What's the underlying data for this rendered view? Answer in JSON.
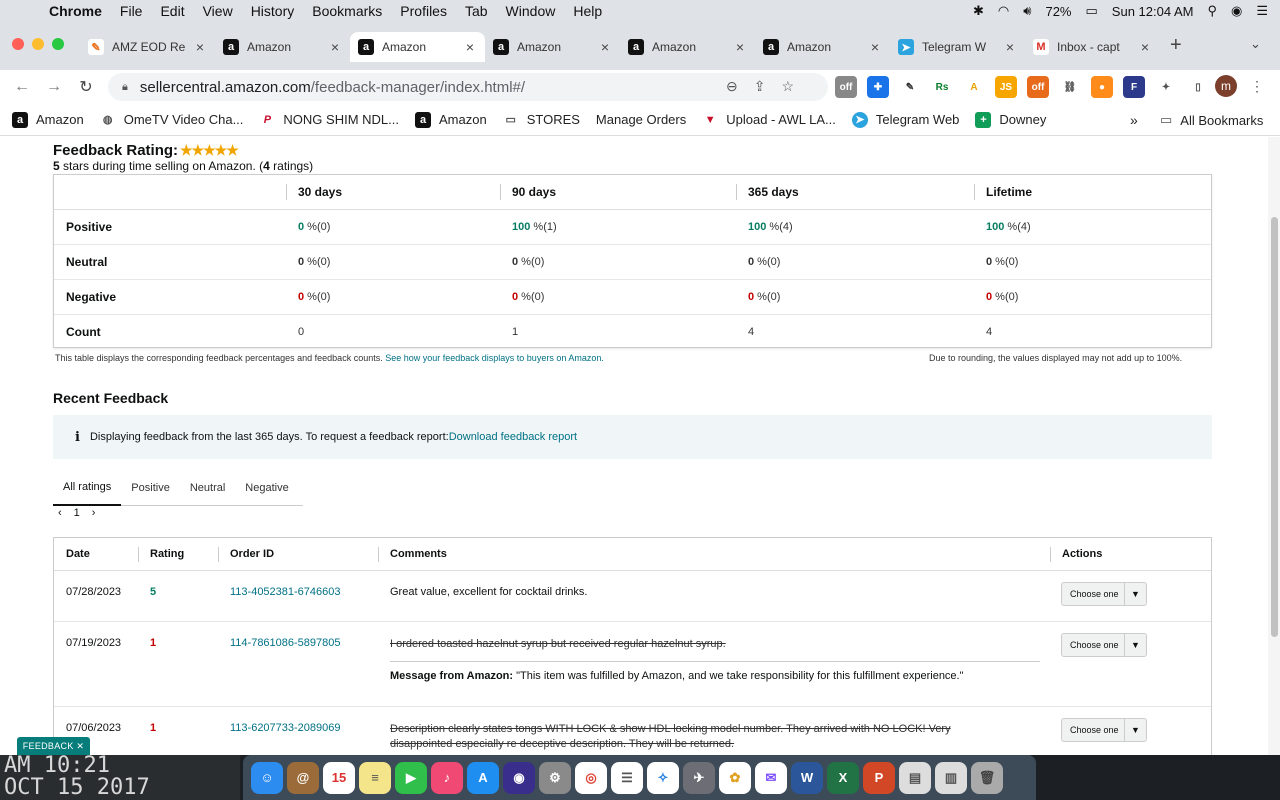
{
  "menubar": {
    "app": "Chrome",
    "items": [
      "File",
      "Edit",
      "View",
      "History",
      "Bookmarks",
      "Profiles",
      "Tab",
      "Window",
      "Help"
    ],
    "battery": "72%",
    "clock": "Sun 12:04 AM"
  },
  "tabs": [
    {
      "title": "AMZ EOD Re",
      "icon": "sheets-icon"
    },
    {
      "title": "Amazon",
      "icon": "amazon-icon"
    },
    {
      "title": "Amazon",
      "icon": "amazon-icon",
      "active": true
    },
    {
      "title": "Amazon",
      "icon": "amazon-icon"
    },
    {
      "title": "Amazon",
      "icon": "amazon-icon"
    },
    {
      "title": "Amazon",
      "icon": "amazon-icon"
    },
    {
      "title": "Telegram W",
      "icon": "telegram-icon"
    },
    {
      "title": "Inbox - capt",
      "icon": "gmail-icon"
    }
  ],
  "address": {
    "host": "sellercentral.amazon.com",
    "path": "/feedback-manager/index.html#/"
  },
  "profile_initial": "m",
  "bookmarks": [
    {
      "label": "Amazon"
    },
    {
      "label": "OmeTV Video Cha..."
    },
    {
      "label": "NONG SHIM NDL..."
    },
    {
      "label": "Amazon"
    },
    {
      "label": "STORES"
    },
    {
      "label": "Manage Orders"
    },
    {
      "label": "Upload - AWL LA..."
    },
    {
      "label": "Telegram Web"
    },
    {
      "label": "Downey"
    }
  ],
  "bookmarks_more": "»",
  "all_bookmarks": "All Bookmarks",
  "feedback_rating": {
    "title": "Feedback Rating:",
    "stars": "★★★★★",
    "sub_stars": "5",
    "sub_text": " stars during time selling on Amazon. (",
    "sub_count": "4",
    "sub_tail": " ratings)"
  },
  "summary": {
    "columns": [
      "",
      "30 days",
      "90 days",
      "365 days",
      "Lifetime"
    ],
    "rows": [
      {
        "label": "Positive",
        "cells": [
          {
            "v": "0",
            "t": " %(0)"
          },
          {
            "v": "100",
            "t": " %(1)"
          },
          {
            "v": "100",
            "t": " %(4)"
          },
          {
            "v": "100",
            "t": " %(4)"
          }
        ]
      },
      {
        "label": "Neutral",
        "cells": [
          {
            "v": "0",
            "t": " %(0)"
          },
          {
            "v": "0",
            "t": " %(0)"
          },
          {
            "v": "0",
            "t": " %(0)"
          },
          {
            "v": "0",
            "t": " %(0)"
          }
        ]
      },
      {
        "label": "Negative",
        "cells": [
          {
            "v": "0",
            "t": " %(0)"
          },
          {
            "v": "0",
            "t": " %(0)"
          },
          {
            "v": "0",
            "t": " %(0)"
          },
          {
            "v": "0",
            "t": " %(0)"
          }
        ]
      },
      {
        "label": "Count",
        "cells": [
          {
            "v": "",
            "t": "0"
          },
          {
            "v": "",
            "t": "1"
          },
          {
            "v": "",
            "t": "4"
          },
          {
            "v": "",
            "t": "4"
          }
        ]
      }
    ]
  },
  "notes": {
    "left": "This table displays the corresponding feedback percentages and feedback counts. ",
    "left_link": "See how your feedback displays to buyers on Amazon.",
    "right": "Due to rounding, the values displayed may not add up to 100%."
  },
  "recent": {
    "title": "Recent Feedback",
    "info_text": "Displaying feedback from the last 365 days. To request a feedback report: ",
    "info_link": "Download feedback report",
    "filters": [
      "All ratings",
      "Positive",
      "Neutral",
      "Negative"
    ],
    "page": "1",
    "columns": {
      "date": "Date",
      "rating": "Rating",
      "order": "Order ID",
      "comments": "Comments",
      "actions": "Actions"
    },
    "rows": [
      {
        "date": "07/28/2023",
        "rating": "5",
        "order": "113-4052381-6746603",
        "comment": "Great value, excellent for cocktail drinks.",
        "struck": false,
        "action": "Choose one"
      },
      {
        "date": "07/19/2023",
        "rating": "1",
        "order": "114-7861086-5897805",
        "comment": "I ordered toasted hazelnut syrup but received regular hazelnut syrup.",
        "struck": true,
        "msg_label": "Message from Amazon:",
        "msg": " \"This item was fulfilled by Amazon, and we take responsibility for this fulfillment experience.\"",
        "action": "Choose one"
      },
      {
        "date": "07/06/2023",
        "rating": "1",
        "order": "113-6207733-2089069",
        "comment": "Description clearly states tongs WITH LOCK & show HDL locking model number. They arrived with NO LOCK! Very disappointed especially re deceptive description. They will be returned.",
        "struck": true,
        "action": "Choose one"
      }
    ]
  },
  "feedback_tab": "FEEDBACK ✕",
  "wallpaper_clock": {
    "line1": "AM 10:21",
    "line2": "OCT 15 2017"
  },
  "colors": {
    "positive": "#067d62",
    "negative": "#c40000",
    "link": "#007185",
    "star": "#f0a500"
  }
}
